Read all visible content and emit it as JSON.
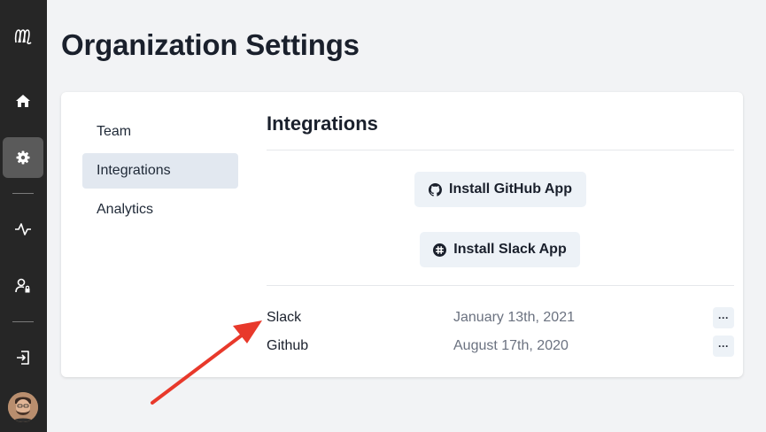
{
  "page": {
    "title": "Organization Settings"
  },
  "sidebar": {
    "items": [
      {
        "name": "logo-icon"
      },
      {
        "name": "home-icon"
      },
      {
        "name": "gear-icon",
        "active": true
      },
      {
        "name": "activity-icon"
      },
      {
        "name": "user-lock-icon"
      },
      {
        "name": "logout-icon"
      }
    ]
  },
  "settings_nav": {
    "items": [
      {
        "label": "Team"
      },
      {
        "label": "Integrations",
        "active": true
      },
      {
        "label": "Analytics"
      }
    ]
  },
  "integrations": {
    "title": "Integrations",
    "github_button": "Install GitHub App",
    "slack_button": "Install Slack App",
    "rows": [
      {
        "name": "Slack",
        "date": "January 13th, 2021",
        "more": "···"
      },
      {
        "name": "Github",
        "date": "August 17th, 2020",
        "more": "···"
      }
    ]
  },
  "colors": {
    "sidebar_bg": "#262626",
    "page_bg": "#f2f3f5",
    "button_bg": "#edf2f7",
    "annotation_arrow": "#e8392b"
  }
}
